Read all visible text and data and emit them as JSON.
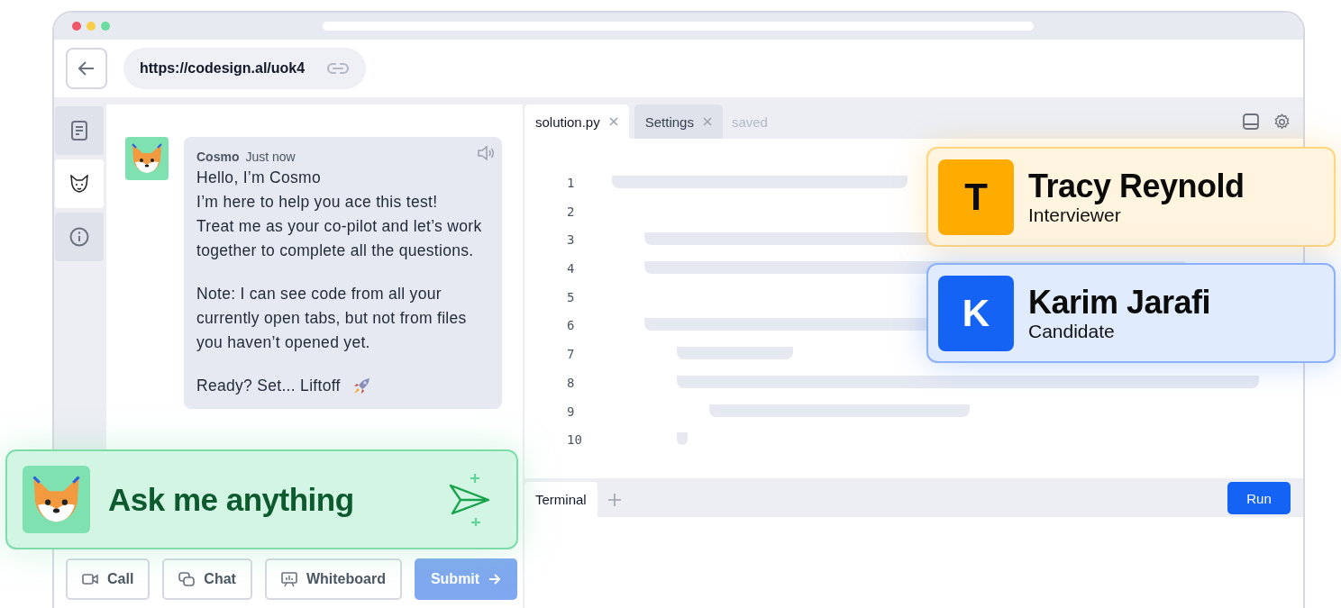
{
  "window": {
    "url": "https://codesign.al/uok4"
  },
  "rail": [
    {
      "kind": "document",
      "selected": false
    },
    {
      "kind": "fox",
      "selected": true
    },
    {
      "kind": "info",
      "selected": false
    }
  ],
  "chat": {
    "messages": [
      {
        "author": "Cosmo",
        "time": "Just now",
        "paragraphs": [
          "Hello, I’m Cosmo\nI’m here to help you ace this test!\nTreat me as your co-pilot and let’s work together to complete all the questions.",
          "Note: I can see code from all your currently open tabs, but not from files you haven’t opened yet.",
          "Ready? Set... Liftoff"
        ]
      }
    ]
  },
  "editor": {
    "tabs": [
      {
        "label": "solution.py",
        "selected": true
      },
      {
        "label": "Settings",
        "selected": false
      }
    ],
    "status": "saved",
    "line_numbers": [
      "1",
      "2",
      "3",
      "4",
      "5",
      "6",
      "7",
      "8",
      "9",
      "10"
    ],
    "terminal_tabs": [
      {
        "label": "Terminal",
        "selected": true
      }
    ],
    "run_button": "Run"
  },
  "actions": [
    {
      "kind": "video",
      "label": "Call"
    },
    {
      "kind": "chat",
      "label": "Chat"
    },
    {
      "kind": "whiteboard",
      "label": "Whiteboard"
    }
  ],
  "submit": {
    "label": "Submit",
    "disabled": true
  },
  "ask": {
    "label": "Ask me anything"
  },
  "participants": [
    {
      "initial": "T",
      "name": "Tracy Reynold",
      "role": "Interviewer",
      "color": "#ffab00"
    },
    {
      "initial": "K",
      "name": "Karim Jarafi",
      "role": "Candidate",
      "color": "#1463f5"
    }
  ]
}
